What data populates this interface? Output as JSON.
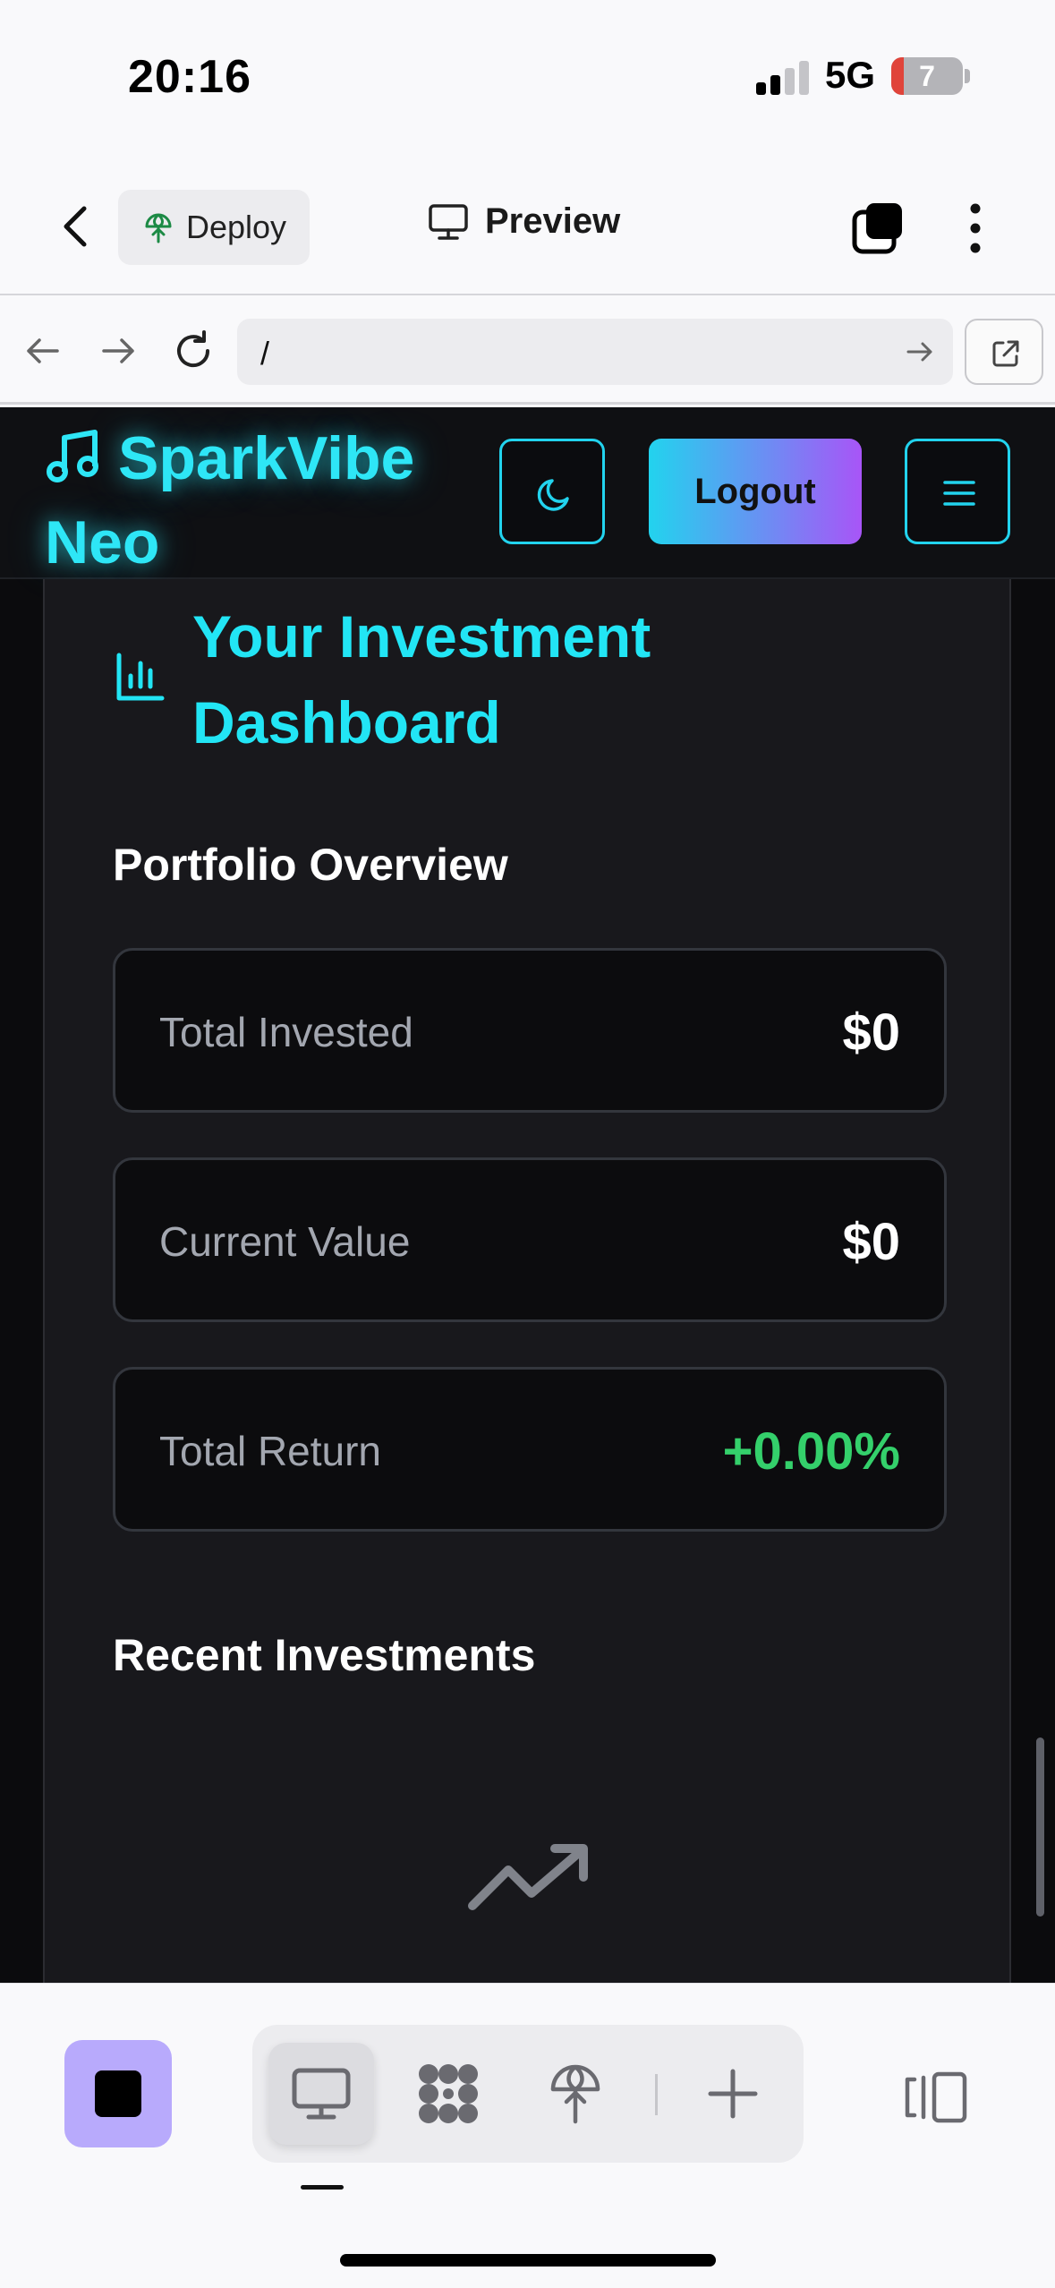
{
  "status_bar": {
    "time": "20:16",
    "network": "5G",
    "battery_level": "7"
  },
  "app_header": {
    "deploy_label": "Deploy",
    "preview_label": "Preview"
  },
  "url_bar": {
    "url": "/"
  },
  "site": {
    "brand": "SparkVibe Neo",
    "logout_label": "Logout"
  },
  "dashboard": {
    "title": "Your Investment Dashboard",
    "portfolio_heading": "Portfolio Overview",
    "stats": [
      {
        "label": "Total Invested",
        "value": "$0"
      },
      {
        "label": "Current Value",
        "value": "$0"
      },
      {
        "label": "Total Return",
        "value": "+0.00%"
      }
    ],
    "recent_heading": "Recent Investments"
  },
  "colors": {
    "accent_cyan": "#22e5f5",
    "accent_purple": "#a855f7",
    "positive_green": "#34d06b",
    "stop_button": "#b8aafc"
  },
  "icons": {
    "brand": "music-note-icon",
    "dashboard": "bar-chart-icon",
    "empty_state": "trending-up-icon",
    "theme": "moon-icon",
    "menu": "hamburger-icon"
  }
}
